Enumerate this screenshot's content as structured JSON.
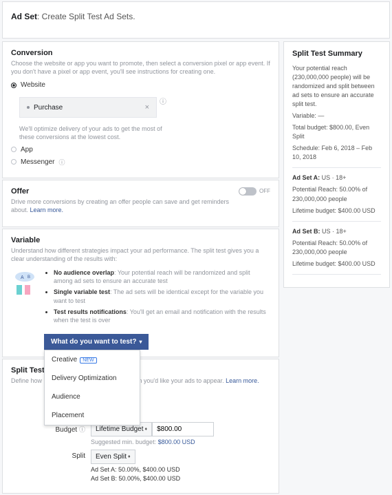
{
  "header": {
    "title": "Ad Set",
    "subtitle": ": Create Split Test Ad Sets."
  },
  "conversion": {
    "title": "Conversion",
    "sub": "Choose the website or app you want to promote, then select a conversion pixel or app event. If you don't have a pixel or app event, you'll see instructions for creating one.",
    "website": "Website",
    "event": "Purchase",
    "note": "We'll optimize delivery of your ads to get the most of these conversions at the lowest cost.",
    "app": "App",
    "messenger": "Messenger"
  },
  "offer": {
    "title": "Offer",
    "sub": "Drive more conversions by creating an offer people can save and get reminders about. ",
    "learn": "Learn more.",
    "state": "OFF"
  },
  "variable": {
    "title": "Variable",
    "sub": "Understand how different strategies impact your ad performance. The split test gives you a clear understanding of the results with:",
    "b1t": "No audience overlap",
    "b1d": ": Your potential reach will be randomized and split among ad sets to ensure an accurate test",
    "b2t": "Single variable test",
    "b2d": ": The ad sets will be identical except for the variable you want to test",
    "b3t": "Test results notifications",
    "b3d": ": You'll get an email and notification with the results when the test is over",
    "btn": "What do you want to test?",
    "m1": "Creative",
    "m1new": "NEW",
    "m2": "Delivery Optimization",
    "m3": "Audience",
    "m4": "Placement"
  },
  "budget": {
    "title": "Split Test Budget & Schedule",
    "sub": "Define how much you'd like to spend, and when you'd like your ads to appear. ",
    "learn": "Learn more.",
    "budget_lbl": "Budget",
    "budget_type": "Lifetime Budget",
    "budget_amt": "$800.00",
    "suggest_pre": "Suggested min. budget: ",
    "suggest_val": "$800.00 USD",
    "split_lbl": "Split",
    "split_val": "Even Split",
    "a": "Ad Set A: 50.00%, $400.00 USD",
    "b": "Ad Set B: 50.00%, $400.00 USD"
  },
  "summary": {
    "title": "Split Test Summary",
    "intro": "Your potential reach (230,000,000 people) will be randomized and split between ad sets to ensure an accurate split test.",
    "var_lbl": "Variable:",
    "var_val": " —",
    "tb_lbl": "Total budget:",
    "tb_val": " $800.00, Even Split",
    "sch_lbl": "Schedule:",
    "sch_val": " Feb 6, 2018 – Feb 10, 2018",
    "a_t": "Ad Set A:",
    "a_v": " US · 18+",
    "a_r_lbl": "Potential Reach:",
    "a_r_val": " 50.00% of 230,000,000 people",
    "a_b_lbl": "Lifetime budget:",
    "a_b_val": " $400.00 USD",
    "b_t": "Ad Set B:",
    "b_v": " US · 18+",
    "b_r_lbl": "Potential Reach:",
    "b_r_val": " 50.00% of 230,000,000 people",
    "b_b_lbl": "Lifetime budget:",
    "b_b_val": " $400.00 USD"
  }
}
